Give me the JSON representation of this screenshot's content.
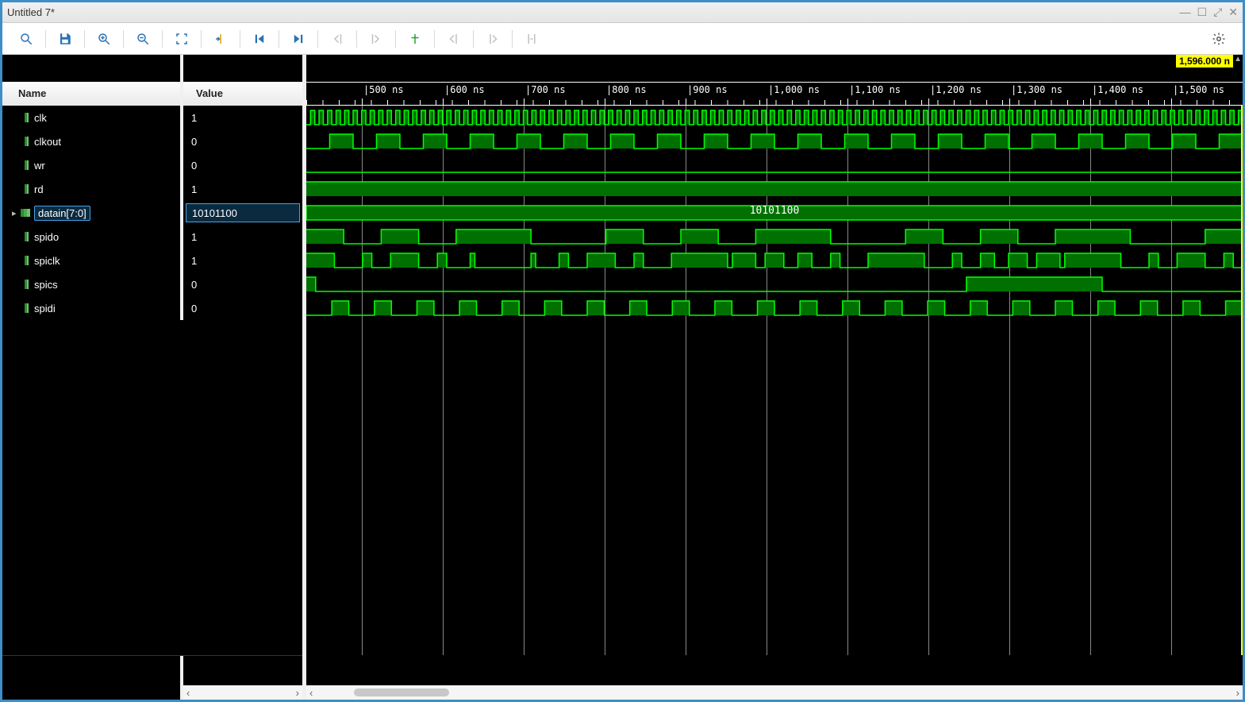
{
  "window": {
    "title": "Untitled 7*"
  },
  "cursor_time": "1,596.000 n",
  "columns": {
    "name": "Name",
    "value": "Value"
  },
  "time_ticks": [
    {
      "label": "500 ns"
    },
    {
      "label": "600 ns"
    },
    {
      "label": "700 ns"
    },
    {
      "label": "800 ns"
    },
    {
      "label": "900 ns"
    },
    {
      "label": "1,000 ns"
    },
    {
      "label": "1,100 ns"
    },
    {
      "label": "1,200 ns"
    },
    {
      "label": "1,300 ns"
    },
    {
      "label": "1,400 ns"
    },
    {
      "label": "1,500 ns"
    }
  ],
  "signals": [
    {
      "name": "clk",
      "value": "1",
      "type": "scalar",
      "wave_kind": "clock_fast"
    },
    {
      "name": "clkout",
      "value": "0",
      "type": "scalar",
      "wave_kind": "clock_slow"
    },
    {
      "name": "wr",
      "value": "0",
      "type": "scalar",
      "wave_kind": "low"
    },
    {
      "name": "rd",
      "value": "1",
      "type": "scalar",
      "wave_kind": "high"
    },
    {
      "name": "datain[7:0]",
      "value": "10101100",
      "type": "bus",
      "wave_kind": "bus",
      "bus_label": "10101100",
      "selected": true,
      "expandable": true
    },
    {
      "name": "spido",
      "value": "1",
      "type": "scalar",
      "wave_kind": "data1"
    },
    {
      "name": "spiclk",
      "value": "1",
      "type": "scalar",
      "wave_kind": "data2"
    },
    {
      "name": "spics",
      "value": "0",
      "type": "scalar",
      "wave_kind": "cs"
    },
    {
      "name": "spidi",
      "value": "0",
      "type": "scalar",
      "wave_kind": "clock_mid"
    }
  ],
  "toolbar_icons": [
    "search-icon",
    "save-icon",
    "zoom-in-icon",
    "zoom-out-icon",
    "zoom-fit-icon",
    "goto-cursor-icon",
    "goto-start-icon",
    "goto-end-icon",
    "prev-edge-icon",
    "next-edge-icon",
    "add-marker-icon",
    "prev-marker-icon",
    "next-marker-icon",
    "swap-marker-icon"
  ],
  "colors": {
    "wave_bright": "#00ff00",
    "wave_fill": "#007000",
    "cursor": "#ffff00",
    "grid": "#888888"
  }
}
